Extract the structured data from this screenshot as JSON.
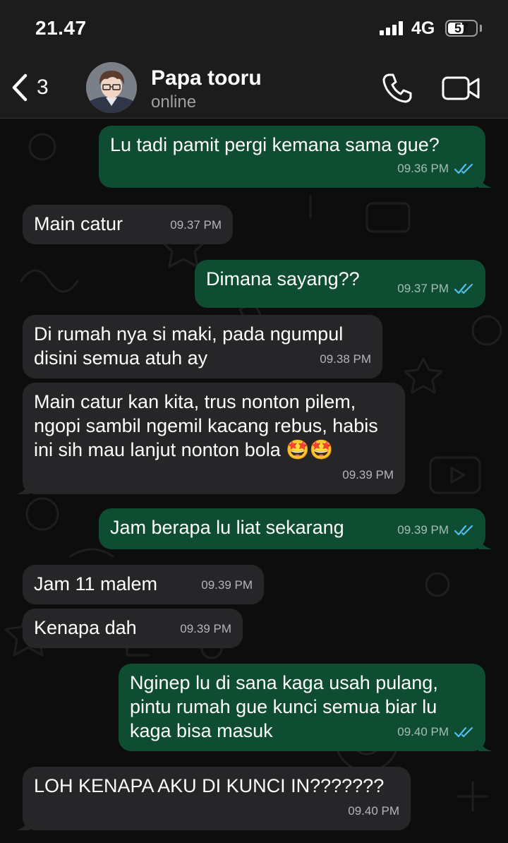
{
  "status_bar": {
    "time": "21.47",
    "network": "4G",
    "battery_level": "57",
    "battery_fraction": 0.57
  },
  "header": {
    "back_count": "3",
    "contact_name": "Papa tooru",
    "contact_status": "online"
  },
  "colors": {
    "incoming_bubble": "#262628",
    "outgoing_bubble": "#0f4d33",
    "read_tick": "#53bdeb"
  },
  "messages": [
    {
      "direction": "out",
      "text": "Lu tadi pamit pergi kemana sama gue?",
      "time": "09.36 PM",
      "read": true
    },
    {
      "direction": "in",
      "text": "Main catur",
      "time": "09.37 PM"
    },
    {
      "direction": "out",
      "text": "Dimana sayang??",
      "time": "09.37 PM",
      "read": true
    },
    {
      "direction": "in",
      "text": "Di rumah nya si maki, pada ngumpul disini semua atuh ay",
      "time": "09.38 PM"
    },
    {
      "direction": "in",
      "text": "Main catur kan kita, trus nonton pilem, ngopi sambil ngemil kacang rebus, habis ini sih mau lanjut nonton bola 🤩🤩",
      "time": "09.39 PM"
    },
    {
      "direction": "out",
      "text": "Jam berapa lu liat sekarang",
      "time": "09.39 PM",
      "read": true
    },
    {
      "direction": "in",
      "text": "Jam 11 malem",
      "time": "09.39 PM"
    },
    {
      "direction": "in",
      "text": "Kenapa dah",
      "time": "09.39 PM"
    },
    {
      "direction": "out",
      "text": "Nginep lu di sana kaga usah pulang, pintu rumah gue kunci semua biar lu kaga bisa masuk",
      "time": "09.40 PM",
      "read": true
    },
    {
      "direction": "in",
      "text": "LOH KENAPA AKU DI KUNCI IN???????",
      "time": "09.40 PM"
    }
  ]
}
